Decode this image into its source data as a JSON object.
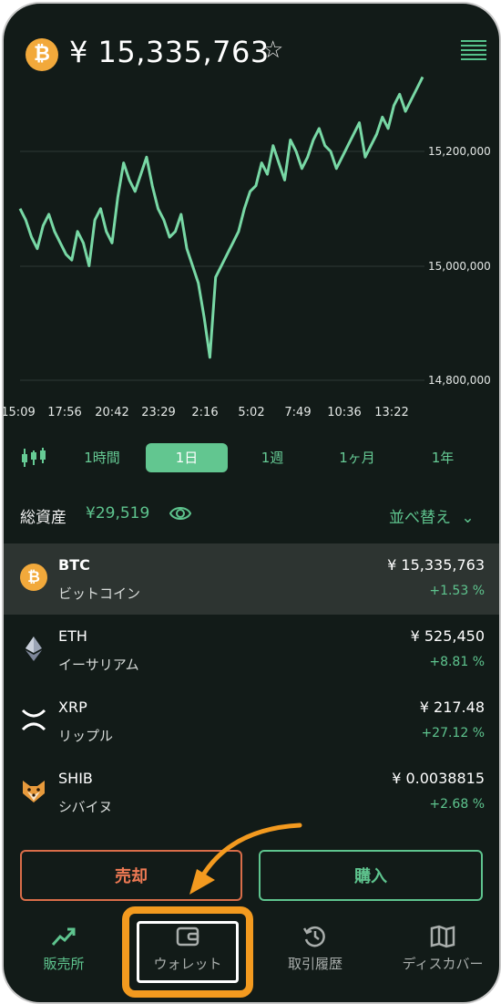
{
  "header": {
    "coin_icon": "bitcoin-icon",
    "coin_glyph": "₿",
    "price": "¥ 15,335,763",
    "star_glyph": "☆",
    "menu_icon": "list-icon"
  },
  "chart_data": {
    "type": "line",
    "x": [
      "15:09",
      "17:56",
      "20:42",
      "23:29",
      "2:16",
      "5:02",
      "7:49",
      "10:36",
      "13:22"
    ],
    "y_ticks": [
      "15,200,000",
      "15,000,000",
      "14,800,000"
    ],
    "ylim": [
      14790000,
      15330000
    ],
    "series": [
      {
        "color": "#78d8a5",
        "values": [
          15100000,
          15080000,
          15050000,
          15030000,
          15070000,
          15090000,
          15060000,
          15040000,
          15020000,
          15010000,
          15060000,
          15040000,
          15000000,
          15080000,
          15100000,
          15060000,
          15040000,
          15120000,
          15180000,
          15150000,
          15130000,
          15160000,
          15190000,
          15140000,
          15100000,
          15080000,
          15050000,
          15060000,
          15090000,
          15030000,
          15000000,
          14970000,
          14910000,
          14840000,
          14980000,
          15000000,
          15020000,
          15040000,
          15060000,
          15100000,
          15130000,
          15140000,
          15180000,
          15160000,
          15210000,
          15180000,
          15150000,
          15220000,
          15200000,
          15170000,
          15190000,
          15220000,
          15240000,
          15210000,
          15200000,
          15170000,
          15190000,
          15210000,
          15230000,
          15250000,
          15190000,
          15210000,
          15230000,
          15260000,
          15240000,
          15280000,
          15300000,
          15270000,
          15290000,
          15310000,
          15330000
        ]
      }
    ]
  },
  "timeframes": {
    "candle_icon": "candlestick-icon",
    "items": [
      "1時間",
      "1日",
      "1週",
      "1ヶ月",
      "1年"
    ],
    "active": "1日"
  },
  "assets": {
    "label": "総資産",
    "value": "¥29,519",
    "eye_icon": "eye-icon",
    "sort_label": "並べ替え"
  },
  "coins": [
    {
      "symbol": "BTC",
      "name": "ビットコイン",
      "price": "¥ 15,335,763",
      "change": "+1.53 %",
      "icon": "bitcoin-icon",
      "selected": true
    },
    {
      "symbol": "ETH",
      "name": "イーサリアム",
      "price": "¥ 525,450",
      "change": "+8.81 %",
      "icon": "ethereum-icon",
      "selected": false
    },
    {
      "symbol": "XRP",
      "name": "リップル",
      "price": "¥ 217.48",
      "change": "+27.12 %",
      "icon": "xrp-icon",
      "selected": false
    },
    {
      "symbol": "SHIB",
      "name": "シバイヌ",
      "price": "¥ 0.0038815",
      "change": "+2.68 %",
      "icon": "shiba-icon",
      "selected": false
    }
  ],
  "actions": {
    "sell": "売却",
    "buy": "購入"
  },
  "tabs": [
    {
      "label": "販売所",
      "icon": "trend-up-icon",
      "active": true
    },
    {
      "label": "ウォレット",
      "icon": "wallet-icon",
      "active": false
    },
    {
      "label": "取引履歴",
      "icon": "history-icon",
      "active": false
    },
    {
      "label": "ディスカバー",
      "icon": "map-icon",
      "active": false
    }
  ],
  "colors": {
    "accent": "#5ec48e",
    "sell": "#ef7a54",
    "background": "#121b18",
    "annotation": "#f39a1f"
  }
}
